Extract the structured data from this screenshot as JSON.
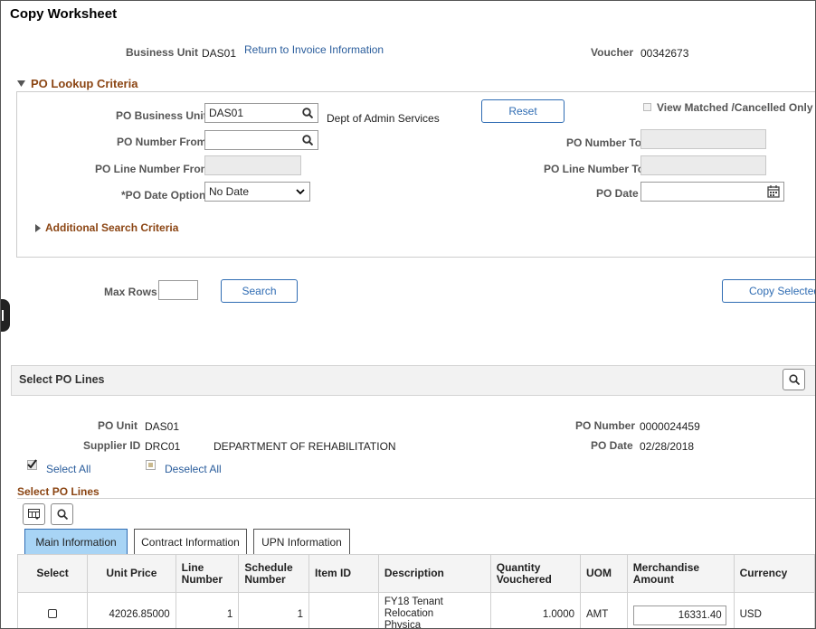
{
  "page": {
    "title": "Copy Worksheet"
  },
  "header": {
    "business_unit_label": "Business Unit",
    "business_unit_value": "DAS01",
    "return_link": "Return to Invoice Information",
    "voucher_label": "Voucher",
    "voucher_value": "00342673"
  },
  "lookup": {
    "section_title": "PO Lookup Criteria",
    "po_business_unit_label": "PO Business Unit",
    "po_business_unit_value": "DAS01",
    "po_business_unit_desc": "Dept of Admin Services",
    "reset_label": "Reset",
    "view_matched_label": "View Matched /Cancelled Only",
    "po_number_from_label": "PO Number From",
    "po_number_from_value": "",
    "po_number_to_label": "PO Number To",
    "po_line_from_label": "PO Line Number From",
    "po_line_to_label": "PO Line Number To",
    "po_date_option_label": "*PO Date Option",
    "po_date_option_value": "No Date",
    "po_date_label": "PO Date",
    "po_date_value": "",
    "additional_label": "Additional Search Criteria"
  },
  "search": {
    "max_rows_label": "Max Rows",
    "max_rows_value": "",
    "search_label": "Search",
    "copy_selected_label": "Copy Selected L"
  },
  "select_po": {
    "header_title": "Select PO Lines",
    "po_unit_label": "PO Unit",
    "po_unit_value": "DAS01",
    "supplier_id_label": "Supplier ID",
    "supplier_id_value": "DRC01",
    "supplier_name": "DEPARTMENT OF REHABILITATION",
    "po_number_label": "PO Number",
    "po_number_value": "0000024459",
    "po_date_label": "PO Date",
    "po_date_value": "02/28/2018",
    "select_all_label": "Select All",
    "deselect_all_label": "Deselect All",
    "grid_title": "Select PO Lines"
  },
  "tabs": [
    {
      "label": "Main Information",
      "active": true
    },
    {
      "label": "Contract Information",
      "active": false
    },
    {
      "label": "UPN Information",
      "active": false
    }
  ],
  "grid": {
    "headers": {
      "select": "Select",
      "unit_price": "Unit Price",
      "line_number": "Line Number",
      "schedule_number": "Schedule Number",
      "item_id": "Item ID",
      "description": "Description",
      "quantity_vouchered": "Quantity Vouchered",
      "uom": "UOM",
      "merchandise_amount": "Merchandise Amount",
      "currency": "Currency"
    },
    "rows": [
      {
        "unit_price": "42026.85000",
        "line_number": "1",
        "schedule_number": "1",
        "item_id": "",
        "description": "FY18 Tenant Relocation Physica",
        "quantity_vouchered": "1.0000",
        "uom": "AMT",
        "merchandise_amount": "16331.40",
        "currency": "USD"
      }
    ]
  },
  "colors": {
    "link": "#2a5d9c",
    "section_title": "#8b4513",
    "active_tab": "#a8d4f5",
    "button_border": "#2f6cb3"
  }
}
